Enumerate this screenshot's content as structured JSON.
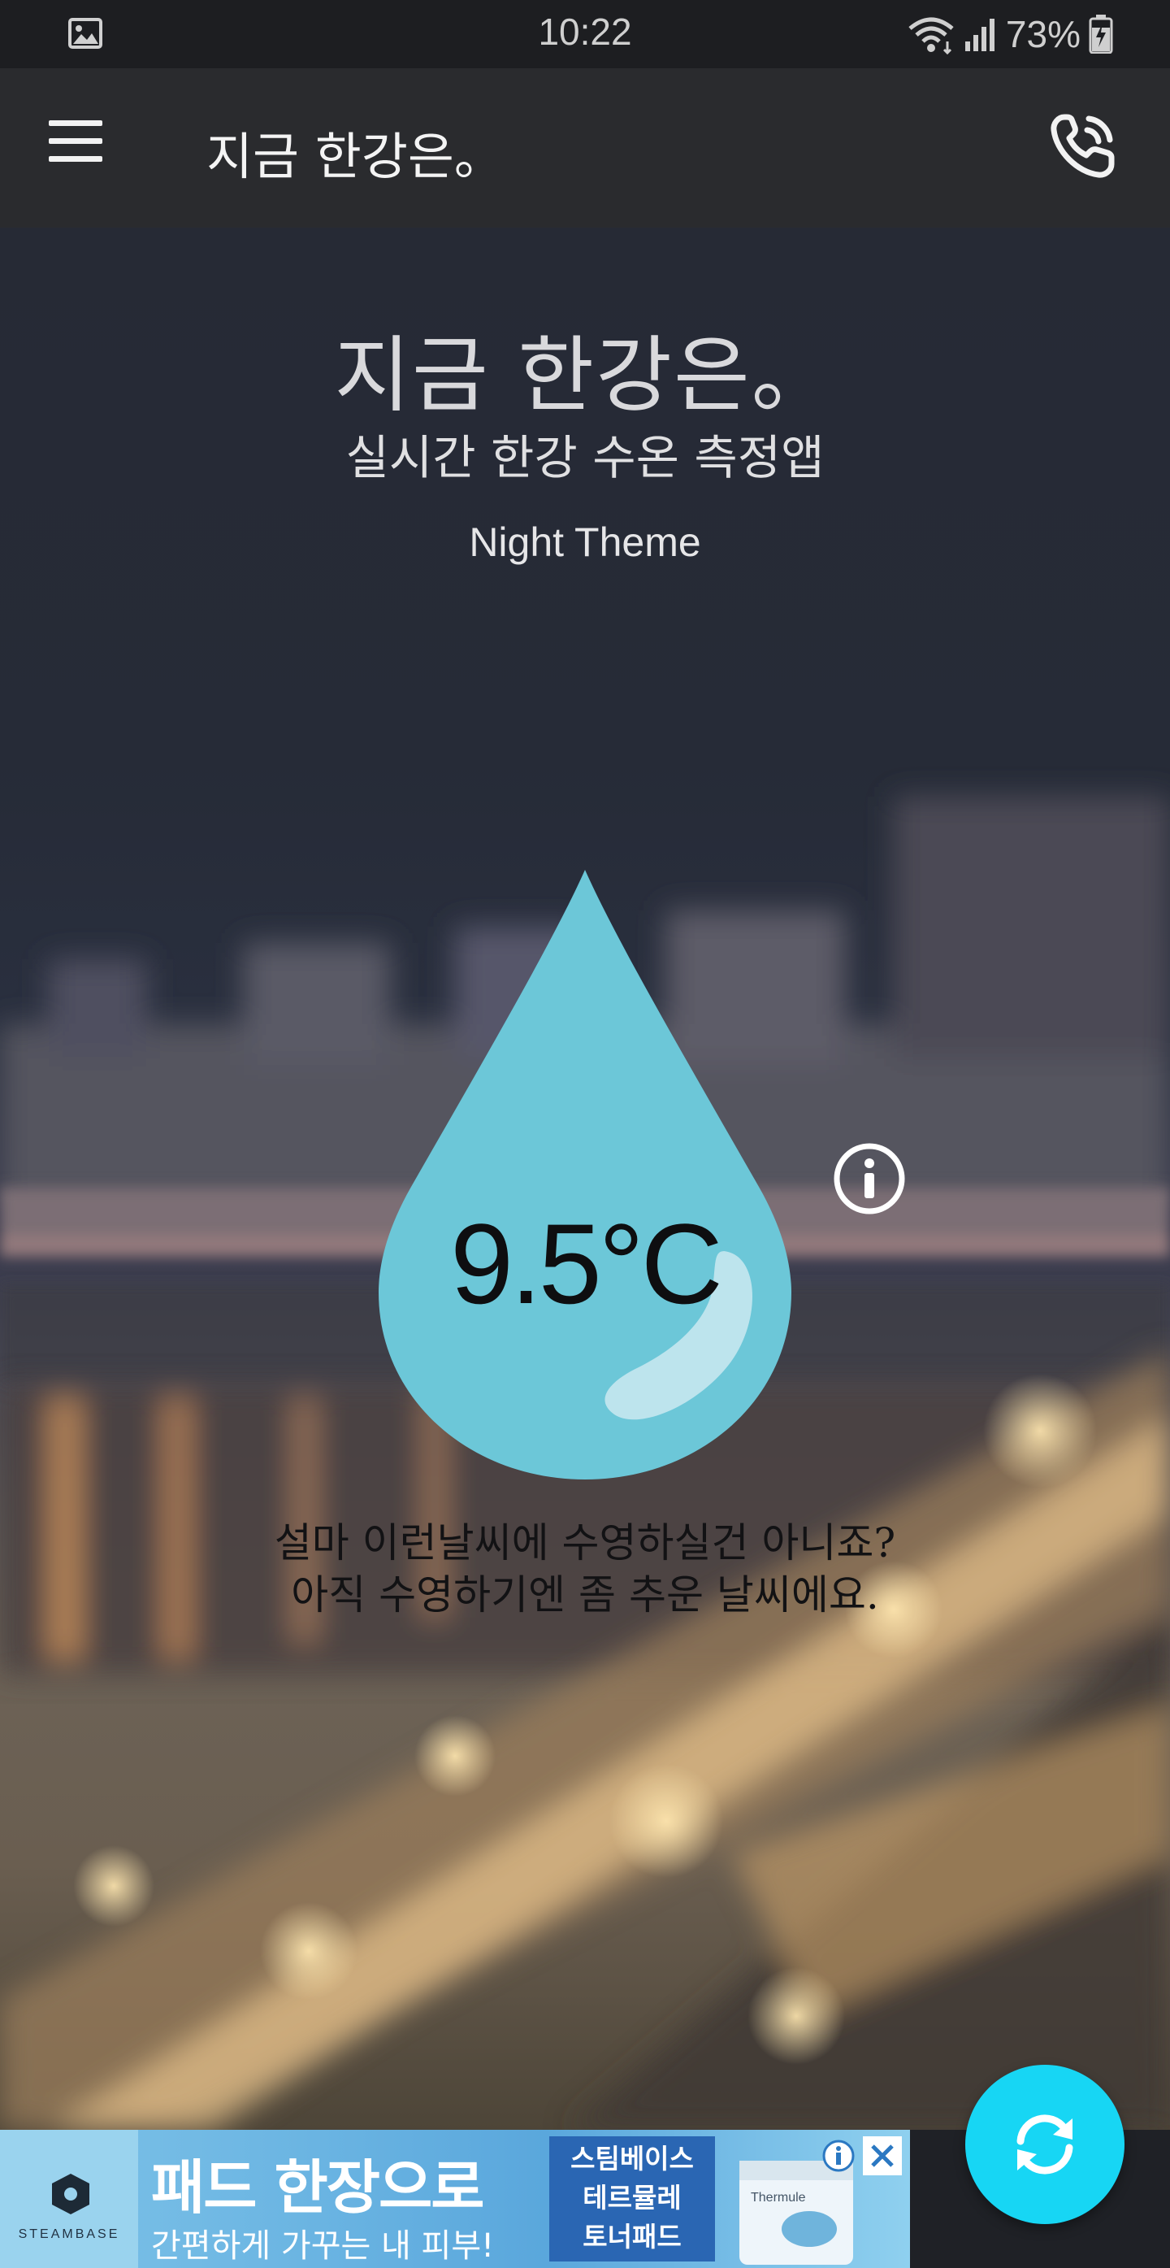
{
  "status_bar": {
    "time": "10:22",
    "battery": "73%",
    "icons": [
      "gallery-icon",
      "wifi-icon",
      "signal-icon",
      "battery-charging-icon"
    ]
  },
  "app_bar": {
    "title": "지금 한강은。",
    "menu_icon": "menu-icon",
    "call_icon": "phone-call-icon"
  },
  "hero": {
    "title": "지금 한강은。",
    "subtitle": "실시간 한강 수온 측정앱",
    "theme": "Night Theme"
  },
  "temperature": {
    "value": "9.5°C",
    "drop_color": "#6cc7d8",
    "info_icon": "info-icon"
  },
  "message": {
    "line1": "설마 이런날씨에 수영하실건 아니죠?",
    "line2": "아직 수영하기엔 좀 추운 날씨에요."
  },
  "ad": {
    "brand": "STEAMBASE",
    "headline": "패드 한장으로",
    "tagline": "간편하게 가꾸는 내 피부!",
    "product_line1": "스팀베이스",
    "product_line2": "테르뮬레",
    "product_line3": "토너패드",
    "product_label": "Thermule",
    "info_icon": "ad-info-icon",
    "close_icon": "ad-close-icon"
  },
  "fab": {
    "icon": "refresh-icon",
    "color": "#17d6f4"
  }
}
